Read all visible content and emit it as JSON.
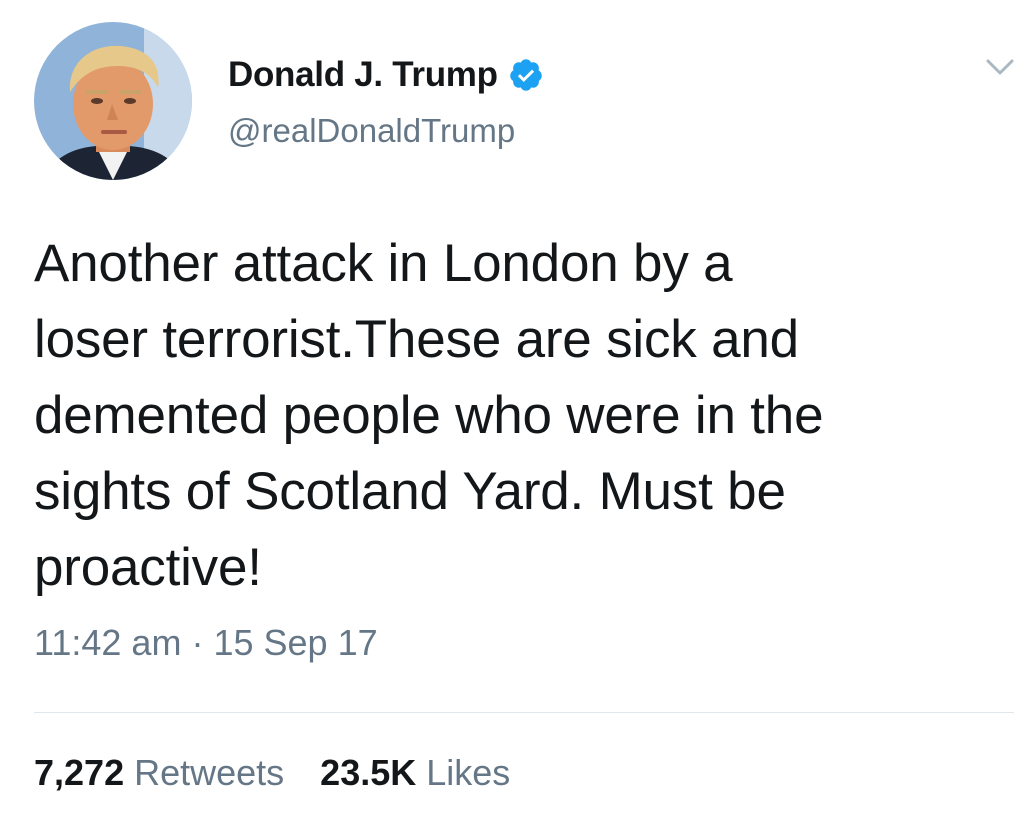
{
  "author": {
    "display_name": "Donald J. Trump",
    "handle": "@realDonaldTrump",
    "verified": true,
    "avatar_icon": "profile-photo",
    "verified_icon": "verified-badge-icon",
    "verified_color": "#1da1f2"
  },
  "menu": {
    "caret_icon": "chevron-down-icon"
  },
  "tweet": {
    "text": "Another attack in London by a\nloser terrorist.These are sick and\ndemented people who were in the\nsights of Scotland Yard. Must be\nproactive!",
    "time": "11:42 am",
    "separator": "·",
    "date": "15 Sep 17"
  },
  "stats": {
    "retweets_count": "7,272",
    "retweets_label": "Retweets",
    "likes_count": "23.5K",
    "likes_label": "Likes"
  },
  "colors": {
    "text_primary": "#14171a",
    "text_secondary": "#657786",
    "divider": "#e1e8ed",
    "accent": "#1da1f2"
  }
}
